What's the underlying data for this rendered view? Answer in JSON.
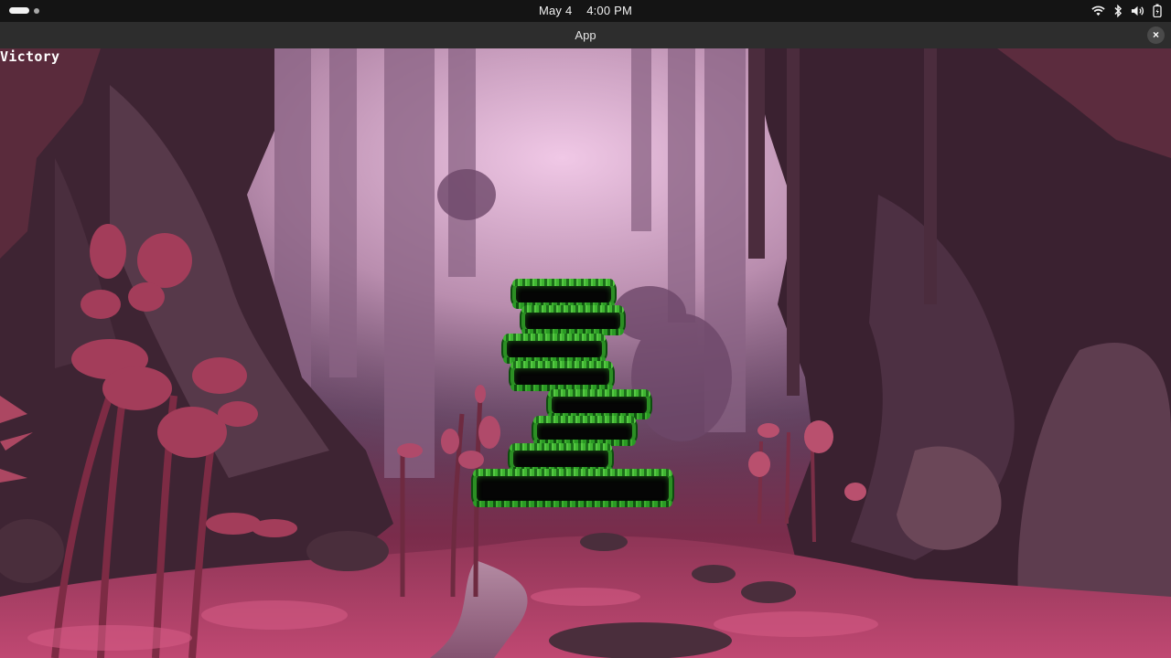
{
  "os_bar": {
    "date": "May 4",
    "time": "4:00 PM",
    "icons": [
      "activities-pill-icon",
      "workspace-dot-icon",
      "wifi-icon",
      "bluetooth-icon",
      "volume-icon",
      "battery-icon"
    ]
  },
  "window": {
    "title": "App",
    "close_label": "×"
  },
  "game": {
    "status_text": "Victory",
    "background": "pink misty cave with red plants",
    "colors": {
      "sky_mist": "#e8bfe0",
      "rock": "#4a2c3e",
      "foliage": "#a33d62",
      "grass": "#2c8f24"
    },
    "platforms": [
      {
        "id": "platform-1"
      },
      {
        "id": "platform-2"
      },
      {
        "id": "platform-3"
      },
      {
        "id": "platform-4"
      },
      {
        "id": "platform-5"
      },
      {
        "id": "platform-6"
      },
      {
        "id": "platform-7"
      },
      {
        "id": "platform-8"
      }
    ]
  }
}
